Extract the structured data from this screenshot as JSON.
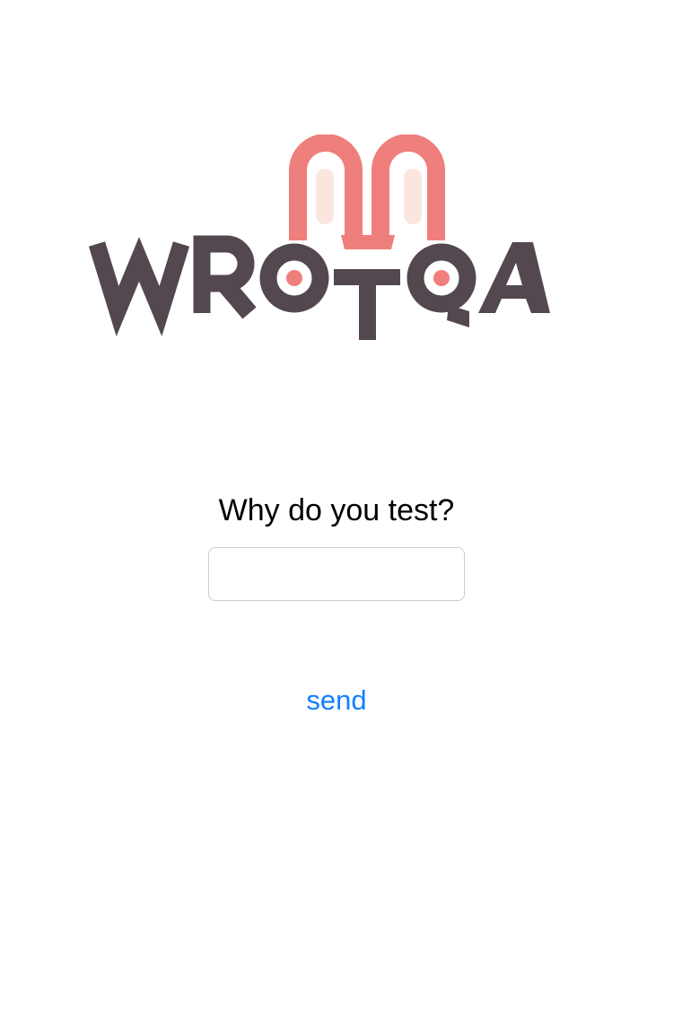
{
  "logo": {
    "text": "WROTQA",
    "colors": {
      "letters": "#544850",
      "ears": "#ef7f7c",
      "inner_ears": "#fbe6df",
      "dots": "#ef7f7c"
    }
  },
  "form": {
    "question": "Why do you test?",
    "answer_value": "",
    "answer_placeholder": "",
    "send_label": "send"
  },
  "colors": {
    "link": "#157efb",
    "input_border": "#cccccc"
  }
}
